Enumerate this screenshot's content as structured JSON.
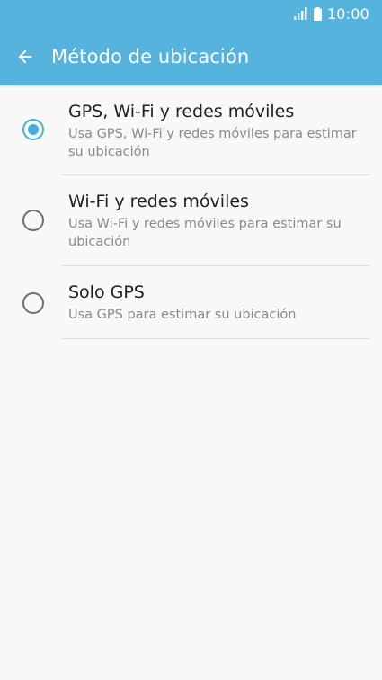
{
  "status_bar": {
    "time": "10:00",
    "signal_icon": "signal-icon",
    "battery_icon": "battery-icon"
  },
  "app_bar": {
    "back_icon": "arrow-back-icon",
    "title": "Método de ubicación"
  },
  "options": [
    {
      "title": "GPS, Wi-Fi y redes móviles",
      "subtitle_line1": "Usa GPS, Wi-Fi y redes móviles para estimar",
      "subtitle_line2": "su ubicación",
      "selected": true
    },
    {
      "title": "Wi-Fi y redes móviles",
      "subtitle_line1": "Usa Wi-Fi y redes móviles para estimar su",
      "subtitle_line2": "ubicación",
      "selected": false
    },
    {
      "title": "Solo GPS",
      "subtitle_line1": "Usa GPS para estimar su ubicación",
      "selected": false
    }
  ],
  "colors": {
    "app_bar": "#55b3dd",
    "accent": "#45b0e0",
    "background": "#f8f8f8"
  }
}
